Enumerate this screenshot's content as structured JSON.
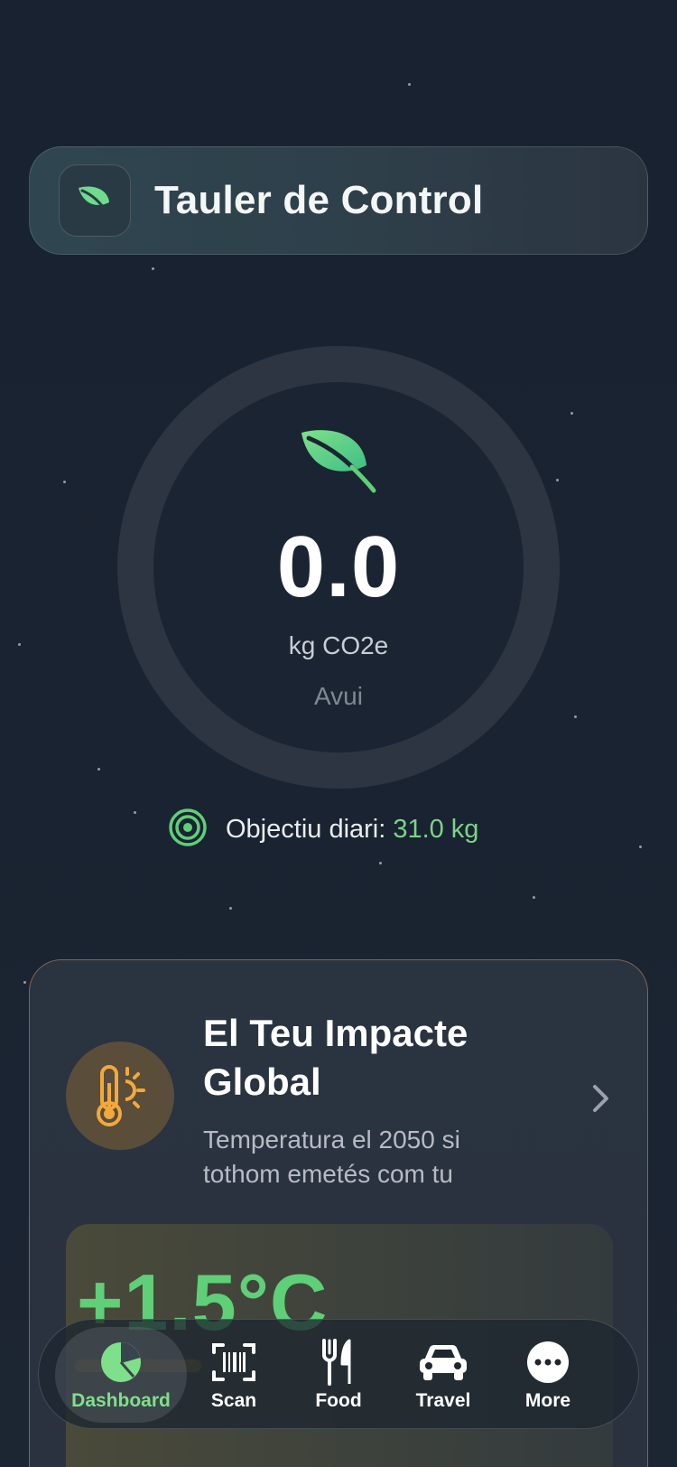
{
  "header": {
    "title": "Tauler de Control",
    "icon": "leaf-icon"
  },
  "emissions": {
    "value": "0.0",
    "unit": "kg CO2e",
    "period": "Avui",
    "progress": 0
  },
  "goal": {
    "label": "Objectiu diari:",
    "value": "31.0 kg"
  },
  "impact": {
    "title": "El Teu Impacte Global",
    "subtitle": "Temperatura el 2050 si tothom emetés com tu",
    "temperature": "+1.5°C",
    "icon": "thermometer-sun-icon"
  },
  "tabs": [
    {
      "label": "Dashboard",
      "icon": "pie-chart-icon",
      "active": true
    },
    {
      "label": "Scan",
      "icon": "barcode-scan-icon",
      "active": false
    },
    {
      "label": "Food",
      "icon": "fork-knife-icon",
      "active": false
    },
    {
      "label": "Travel",
      "icon": "car-icon",
      "active": false
    },
    {
      "label": "More",
      "icon": "more-dots-icon",
      "active": false
    }
  ],
  "colors": {
    "accent": "#7ee08a",
    "brand_green": "#5fcf78",
    "warm": "#f2a93b"
  }
}
